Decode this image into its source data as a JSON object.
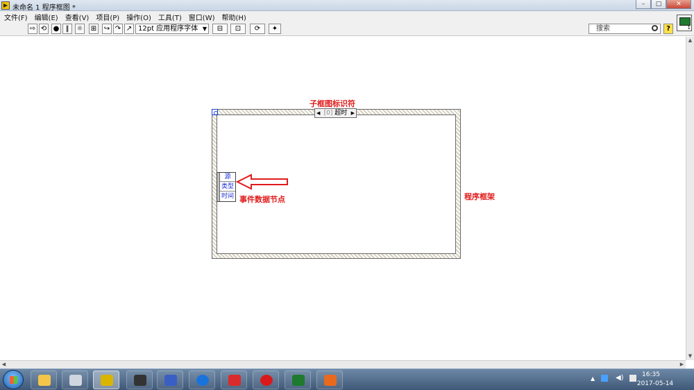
{
  "window": {
    "title": "未命名 1 程序框图 *"
  },
  "menu": [
    "文件(F)",
    "编辑(E)",
    "查看(V)",
    "项目(P)",
    "操作(O)",
    "工具(T)",
    "窗口(W)",
    "帮助(H)"
  ],
  "toolbar": {
    "font": "12pt 应用程序字体",
    "search_placeholder": "搜索",
    "help": "?"
  },
  "vi_icon_badge": "1",
  "event_structure": {
    "selector_index": "[0]",
    "selector_text": "超时",
    "data_node": [
      "源",
      "类型",
      "时间"
    ]
  },
  "annotations": {
    "subframe_label": "子框图标识符",
    "data_node_label": "事件数据节点",
    "frame_label": "程序框架"
  },
  "colors": {
    "annotation": "#e11b1b",
    "node_text": "#1c2fd4"
  },
  "taskbar": {
    "time": "16:35",
    "date": "2017-05-14"
  }
}
